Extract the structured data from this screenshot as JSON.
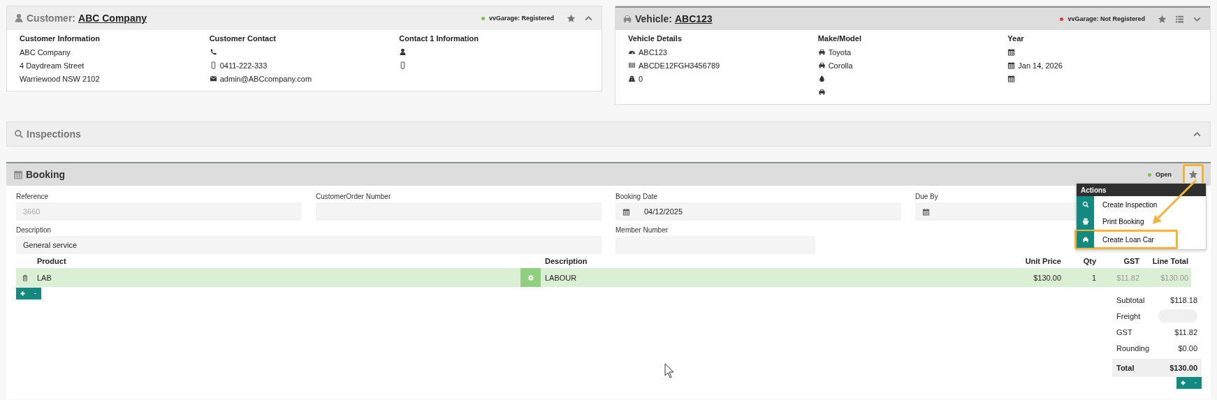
{
  "customer": {
    "active": false,
    "label": "Customer:",
    "name": "ABC Company",
    "status": {
      "text": "vvGarage: Registered",
      "color": "#7ac143"
    },
    "expanded": true,
    "columns": [
      {
        "heading": "Customer Information",
        "lines": [
          {
            "kind": "plain",
            "text": "ABC Company"
          },
          {
            "kind": "plain",
            "text": "4 Daydream Street"
          },
          {
            "kind": "plain",
            "text": "Warriewood NSW 2102"
          }
        ]
      },
      {
        "heading": "Customer Contact",
        "lines": [
          {
            "kind": "phone"
          },
          {
            "kind": "mobile",
            "text": "0411-222-333"
          },
          {
            "kind": "email",
            "text": "admin@ABCcompany.com"
          }
        ]
      },
      {
        "heading": "Contact 1 Information",
        "lines": [
          {
            "kind": "user"
          },
          {
            "kind": "mobile"
          }
        ]
      }
    ]
  },
  "vehicle": {
    "active": true,
    "label": "Vehicle:",
    "name": "ABC123",
    "status": {
      "text": "vvGarage: Not Registered",
      "color": "#e53935"
    },
    "expanded": false,
    "columns": [
      {
        "heading": "Vehicle Details",
        "lines": [
          {
            "kind": "gauge",
            "text": "ABC123"
          },
          {
            "kind": "barcode",
            "text": "ABCDE12FGH3456789"
          },
          {
            "kind": "road",
            "text": "0"
          }
        ]
      },
      {
        "heading": "Make/Model",
        "lines": [
          {
            "kind": "car",
            "text": "Toyota"
          },
          {
            "kind": "car",
            "text": "Corolla"
          },
          {
            "kind": "drop"
          },
          {
            "kind": "car"
          }
        ]
      },
      {
        "heading": "Year",
        "lines": [
          {
            "kind": "calendar"
          },
          {
            "kind": "calendar",
            "text": "Jan 14, 2026"
          },
          {
            "kind": "calendar"
          }
        ]
      }
    ]
  },
  "inspections": {
    "active": false,
    "title": "Inspections",
    "expanded": true
  },
  "booking": {
    "active": true,
    "title": "Booking",
    "status": {
      "text": "Open",
      "color": "#7ac143"
    },
    "star_highlighted": true,
    "fields": [
      {
        "kind": "text",
        "label": "Reference",
        "value": "3660",
        "disabled": true
      },
      {
        "kind": "text",
        "label": "CustomerOrder Number"
      },
      {
        "kind": "date",
        "label": "Booking Date",
        "value": "04/12/2025"
      },
      {
        "kind": "date",
        "label": "Due By"
      },
      {
        "kind": "memo",
        "label": "Description",
        "value": "General service"
      },
      {
        "kind": "short",
        "label": "Member Number"
      }
    ],
    "columns": [
      "Product",
      "Description",
      "Unit Price",
      "Qty",
      "GST",
      "Line Total"
    ],
    "lines": [
      {
        "product": "LAB",
        "description": "LABOUR",
        "unit_price": "$130.00",
        "qty": "1",
        "gst": "$11.82",
        "line_total": "$130.00"
      }
    ],
    "totals": [
      {
        "kind": "text",
        "label": "Subtotal",
        "value": "$118.18"
      },
      {
        "kind": "input",
        "label": "Freight"
      },
      {
        "kind": "text",
        "label": "GST",
        "value": "$11.82"
      },
      {
        "kind": "text",
        "label": "Rounding",
        "value": "$0.00"
      },
      {
        "kind": "total",
        "label": "Total",
        "value": "$130.00"
      }
    ],
    "actions": {
      "title": "Actions",
      "items": [
        {
          "kind": "search",
          "label": "Create Inspection",
          "highlighted": false
        },
        {
          "kind": "print",
          "label": "Print Booking",
          "highlighted": false
        },
        {
          "kind": "car",
          "label": "Create Loan Car",
          "highlighted": true
        }
      ]
    }
  }
}
